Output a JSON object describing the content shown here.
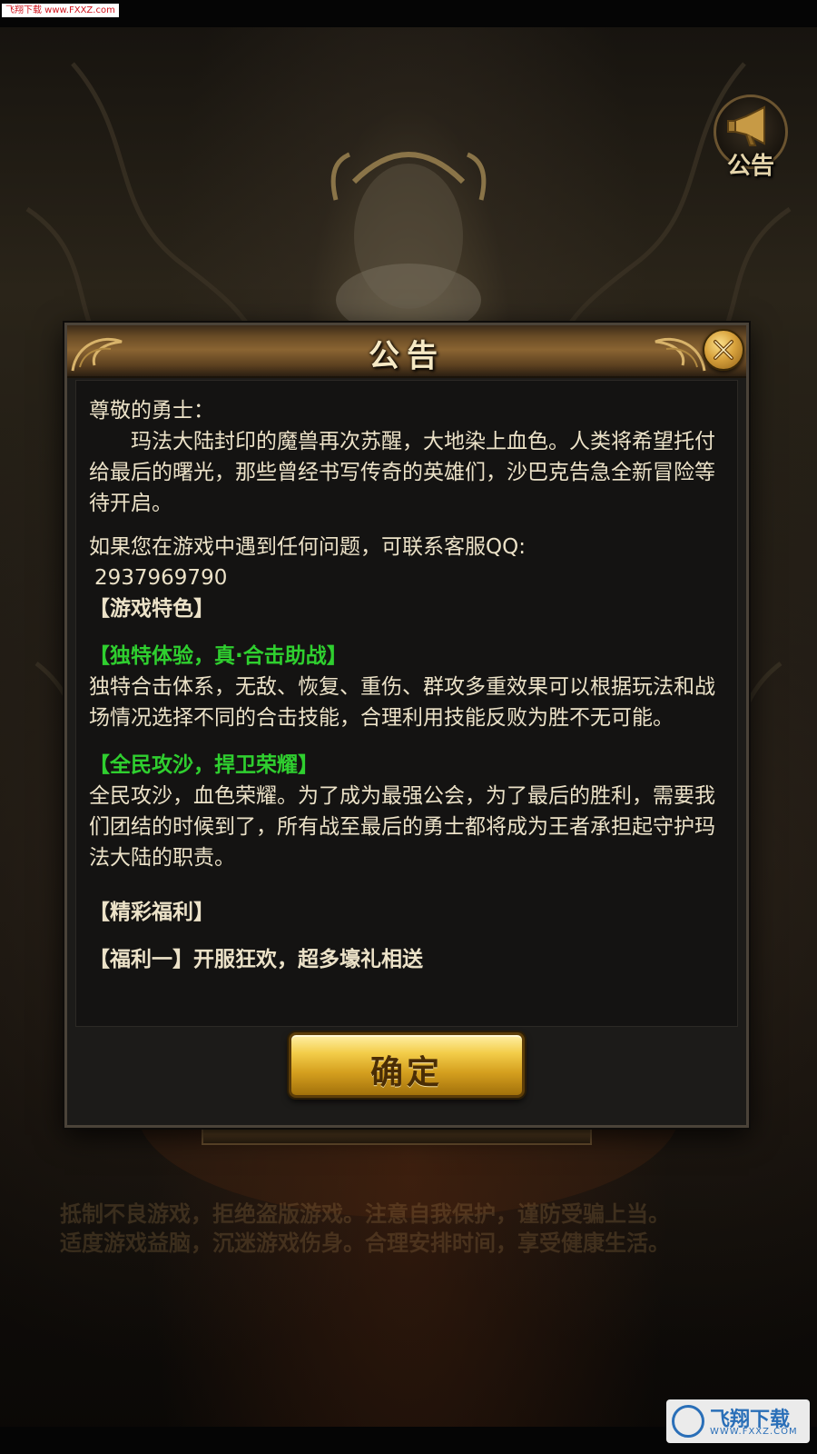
{
  "watermark": {
    "top_text": "飞翔下载 www.FXXZ.com",
    "bottom_text": "飞翔下载",
    "bottom_sub": "WWW.FXXZ.COM"
  },
  "notice_button": {
    "label": "公告",
    "icon": "horn-icon"
  },
  "health_notice": {
    "line1": "抵制不良游戏，拒绝盗版游戏。注意自我保护，谨防受骗上当。",
    "line2": "适度游戏益脑，沉迷游戏伤身。合理安排时间，享受健康生活。"
  },
  "modal": {
    "title": "公告",
    "close_icon": "close-icon",
    "confirm_label": "确定",
    "content": {
      "greeting": "尊敬的勇士：",
      "intro": "玛法大陆封印的魔兽再次苏醒，大地染上血色。人类将希望托付给最后的曙光，那些曾经书写传奇的英雄们，沙巴克告急全新冒险等待开启。",
      "contact": "如果您在游戏中遇到任何问题，可联系客服QQ:",
      "qq": "2937969790",
      "features_heading": "【游戏特色】",
      "feature1_title": "【独特体验，真·合击助战】",
      "feature1_text": "独特合击体系，无敌、恢复、重伤、群攻多重效果可以根据玩法和战场情况选择不同的合击技能，合理利用技能反败为胜不无可能。",
      "feature2_title": "【全民攻沙，捍卫荣耀】",
      "feature2_text": "全民攻沙，血色荣耀。为了成为最强公会，为了最后的胜利，需要我们团结的时候到了，所有战至最后的勇士都将成为王者承担起守护玛法大陆的职责。",
      "welfare_heading": "【精彩福利】",
      "welfare1": "【福利一】开服狂欢，超多壕礼相送"
    }
  },
  "colors": {
    "accent_green": "#2fcf2f",
    "text": "#ece2c8",
    "gold": "#d5a01f"
  }
}
